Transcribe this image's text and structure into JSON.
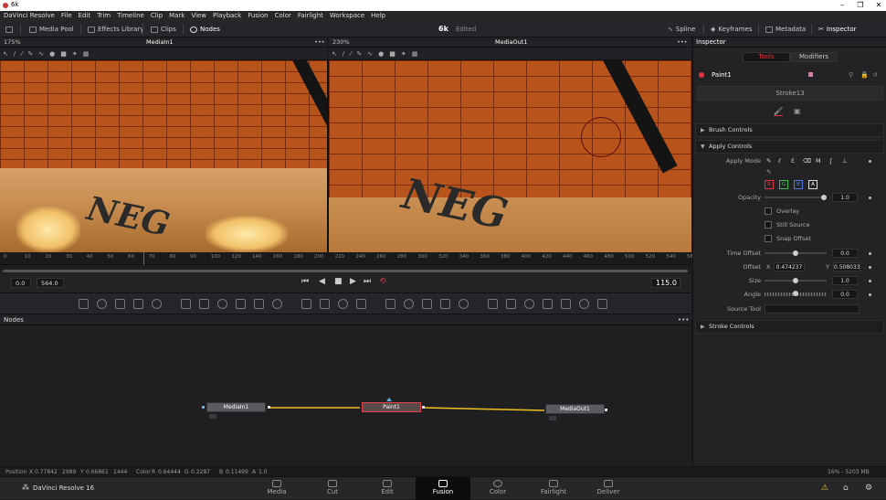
{
  "window": {
    "title": "6k",
    "min": "–",
    "max": "❐",
    "close": "✕"
  },
  "menu": [
    "DaVinci Resolve",
    "File",
    "Edit",
    "Trim",
    "Timeline",
    "Clip",
    "Mark",
    "View",
    "Playback",
    "Fusion",
    "Color",
    "Fairlight",
    "Workspace",
    "Help"
  ],
  "toolbar": {
    "media_pool": "Media Pool",
    "effects_library": "Effects Library",
    "clips": "Clips",
    "nodes": "Nodes",
    "project": "6k",
    "status": "Edited",
    "spline": "Spline",
    "keyframes": "Keyframes",
    "metadata": "Metadata",
    "inspector": "Inspector"
  },
  "viewer_left": {
    "zoom": "175%",
    "name": "MediaIn1",
    "more": "•••",
    "graffiti": "NEG"
  },
  "viewer_right": {
    "zoom": "230%",
    "name": "MediaOut1",
    "more": "•••",
    "graffiti": "NEG"
  },
  "ruler": {
    "ticks": [
      "0",
      "10",
      "20",
      "30",
      "40",
      "50",
      "60",
      "70",
      "80",
      "90",
      "100",
      "120",
      "140",
      "160",
      "180",
      "200",
      "220",
      "240",
      "260",
      "280",
      "300",
      "320",
      "340",
      "360",
      "380",
      "400",
      "420",
      "440",
      "460",
      "480",
      "500",
      "520",
      "540",
      "56"
    ]
  },
  "transport": {
    "start": "0.0",
    "end": "564.0",
    "current": "115.0",
    "playhead_fraction": 0.204
  },
  "nodes": {
    "title": "Nodes",
    "more": "•••",
    "items": [
      {
        "id": "mediain",
        "label": "MediaIn1"
      },
      {
        "id": "paint",
        "label": "Paint1"
      },
      {
        "id": "mediaout",
        "label": "MediaOut1"
      }
    ]
  },
  "inspector": {
    "title": "Inspector",
    "tabs": {
      "tools": "Tools",
      "modifiers": "Modifiers"
    },
    "tool_name": "Paint1",
    "stroke_name": "Stroke13",
    "brush_controls": "Brush Controls",
    "apply_controls": "Apply Controls",
    "stroke_controls": "Stroke Controls",
    "apply_mode_label": "Apply Mode",
    "channels": [
      "R",
      "G",
      "B",
      "A"
    ],
    "opacity": {
      "label": "Opacity",
      "value": "1.0",
      "fraction": 1.0
    },
    "overlay": "Overlay",
    "still_source": "Still Source",
    "snap_offset": "Snap Offset",
    "time_offset": {
      "label": "Time Offset",
      "value": "0.0",
      "fraction": 0.5
    },
    "offset": {
      "label": "Offset",
      "x_label": "X",
      "x": "0.474237",
      "y_label": "Y",
      "y": "0.508033"
    },
    "size": {
      "label": "Size",
      "value": "1.0",
      "fraction": 0.5
    },
    "angle": {
      "label": "Angle",
      "value": "0.0",
      "fraction": 0.5
    },
    "source_tool": "Source Tool"
  },
  "status": {
    "position_label": "Position",
    "x_label": "X",
    "x": "0.77842",
    "px": "2989",
    "y_label": "Y",
    "y": "0.66861",
    "py": "1444",
    "color_label": "Color",
    "r_label": "R",
    "r": "0.64444",
    "g_label": "G",
    "g": "0.2287",
    "b_label": "B",
    "b": "0.11499",
    "a_label": "A",
    "a": "1.0",
    "memory": "16% - 5203 MB"
  },
  "app": {
    "name": "DaVinci Resolve 16"
  },
  "pages": [
    {
      "label": "Media"
    },
    {
      "label": "Cut"
    },
    {
      "label": "Edit"
    },
    {
      "label": "Fusion"
    },
    {
      "label": "Color"
    },
    {
      "label": "Fairlight"
    },
    {
      "label": "Deliver"
    }
  ],
  "colors": {
    "accent": "#e2333f",
    "link": "#f0c020",
    "node_select": "#e0424a",
    "viewer_underline": "#5ab4e8"
  }
}
